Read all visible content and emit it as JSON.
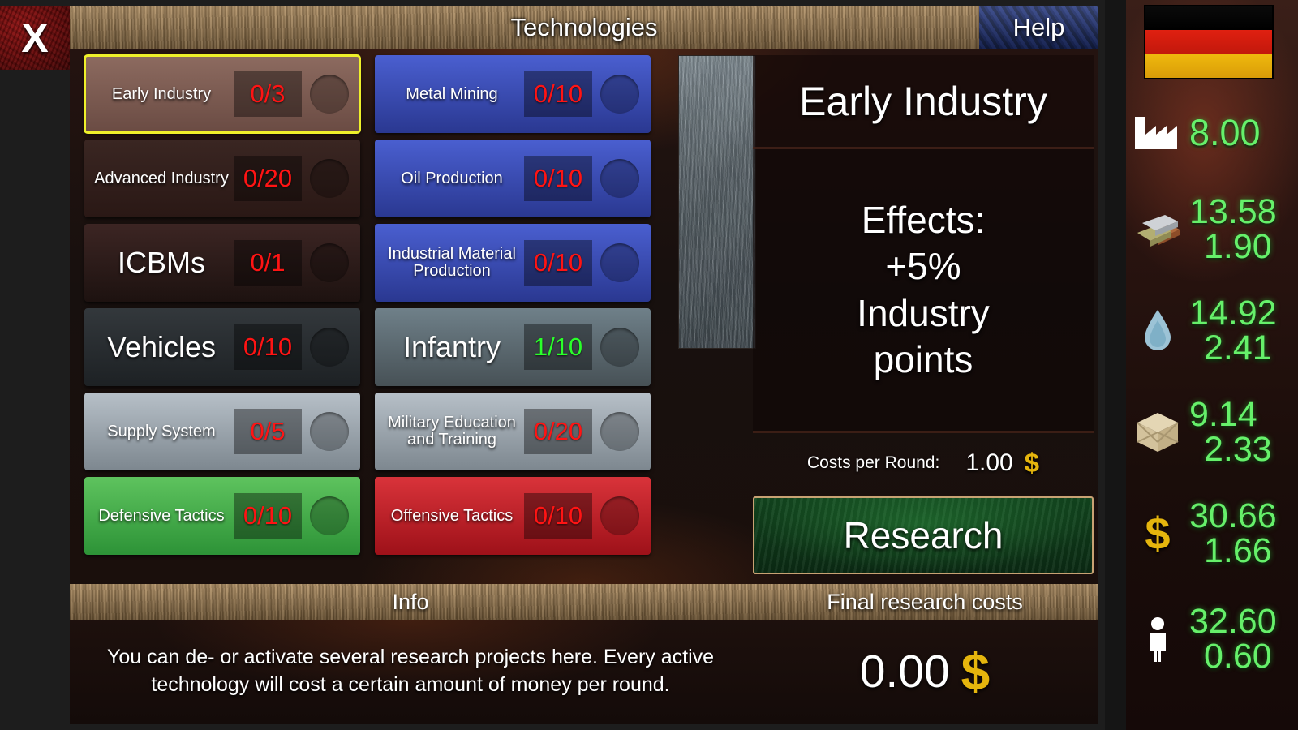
{
  "window": {
    "close_label": "X",
    "title": "Technologies",
    "help_label": "Help"
  },
  "technologies": {
    "left_column": [
      {
        "name": "Early Industry",
        "count": "0/3",
        "state": "zero",
        "palette": "pal-brown",
        "size": "mid",
        "selected": true
      },
      {
        "name": "Advanced\nIndustry",
        "count": "0/20",
        "state": "zero",
        "palette": "pal-dark",
        "size": "mid",
        "selected": false
      },
      {
        "name": "ICBMs",
        "count": "0/1",
        "state": "zero",
        "palette": "pal-black",
        "size": "big",
        "selected": false
      },
      {
        "name": "Vehicles",
        "count": "0/10",
        "state": "zero",
        "palette": "pal-slate",
        "size": "big",
        "selected": false
      },
      {
        "name": "Supply\nSystem",
        "count": "0/5",
        "state": "zero",
        "palette": "pal-silver",
        "size": "mid",
        "selected": false
      },
      {
        "name": "Defensive\nTactics",
        "count": "0/10",
        "state": "zero",
        "palette": "pal-green",
        "size": "mid",
        "selected": false
      }
    ],
    "right_column": [
      {
        "name": "Metal Mining",
        "count": "0/10",
        "state": "zero",
        "palette": "pal-blue",
        "size": "mid",
        "selected": false
      },
      {
        "name": "Oil\nProduction",
        "count": "0/10",
        "state": "zero",
        "palette": "pal-blue",
        "size": "mid",
        "selected": false
      },
      {
        "name": "Industrial Material\nProduction",
        "count": "0/10",
        "state": "zero",
        "palette": "pal-blue",
        "size": "small",
        "selected": false
      },
      {
        "name": "Infantry",
        "count": "1/10",
        "state": "some",
        "palette": "pal-steel",
        "size": "big",
        "selected": false
      },
      {
        "name": "Military Education\nand Training",
        "count": "0/20",
        "state": "zero",
        "palette": "pal-silver",
        "size": "small",
        "selected": false
      },
      {
        "name": "Offensive\nTactics",
        "count": "0/10",
        "state": "zero",
        "palette": "pal-red",
        "size": "mid",
        "selected": false
      }
    ]
  },
  "details": {
    "title": "Early Industry",
    "effects": "Effects:\n+5%\nIndustry\npoints",
    "cost_label": "Costs per Round:",
    "cost_value": "1.00",
    "cost_currency": "$",
    "research_label": "Research"
  },
  "footer": {
    "info_header": "Info",
    "costs_header": "Final research costs",
    "info_text": "You can de- or activate several research projects here. Every active technology will cost a certain amount of money per round.",
    "final_cost_value": "0.00",
    "final_cost_currency": "$"
  },
  "sidebar": {
    "flag": "germany-flag",
    "resources": [
      {
        "icon": "factory-icon",
        "values": [
          "8.00"
        ]
      },
      {
        "icon": "metal-ingot-icon",
        "values": [
          "13.58",
          "1.90"
        ]
      },
      {
        "icon": "water-drop-icon",
        "values": [
          "14.92",
          "2.41"
        ]
      },
      {
        "icon": "crate-icon",
        "values": [
          "9.14",
          "2.33"
        ]
      },
      {
        "icon": "dollar-icon",
        "values": [
          "30.66",
          "1.66"
        ]
      },
      {
        "icon": "population-icon",
        "values": [
          "32.60",
          "0.60"
        ]
      }
    ]
  },
  "colors": {
    "accent_gold": "#e5b50d",
    "value_green": "#66f06a",
    "value_red": "#ff1414",
    "selection_yellow": "#eef02a"
  }
}
